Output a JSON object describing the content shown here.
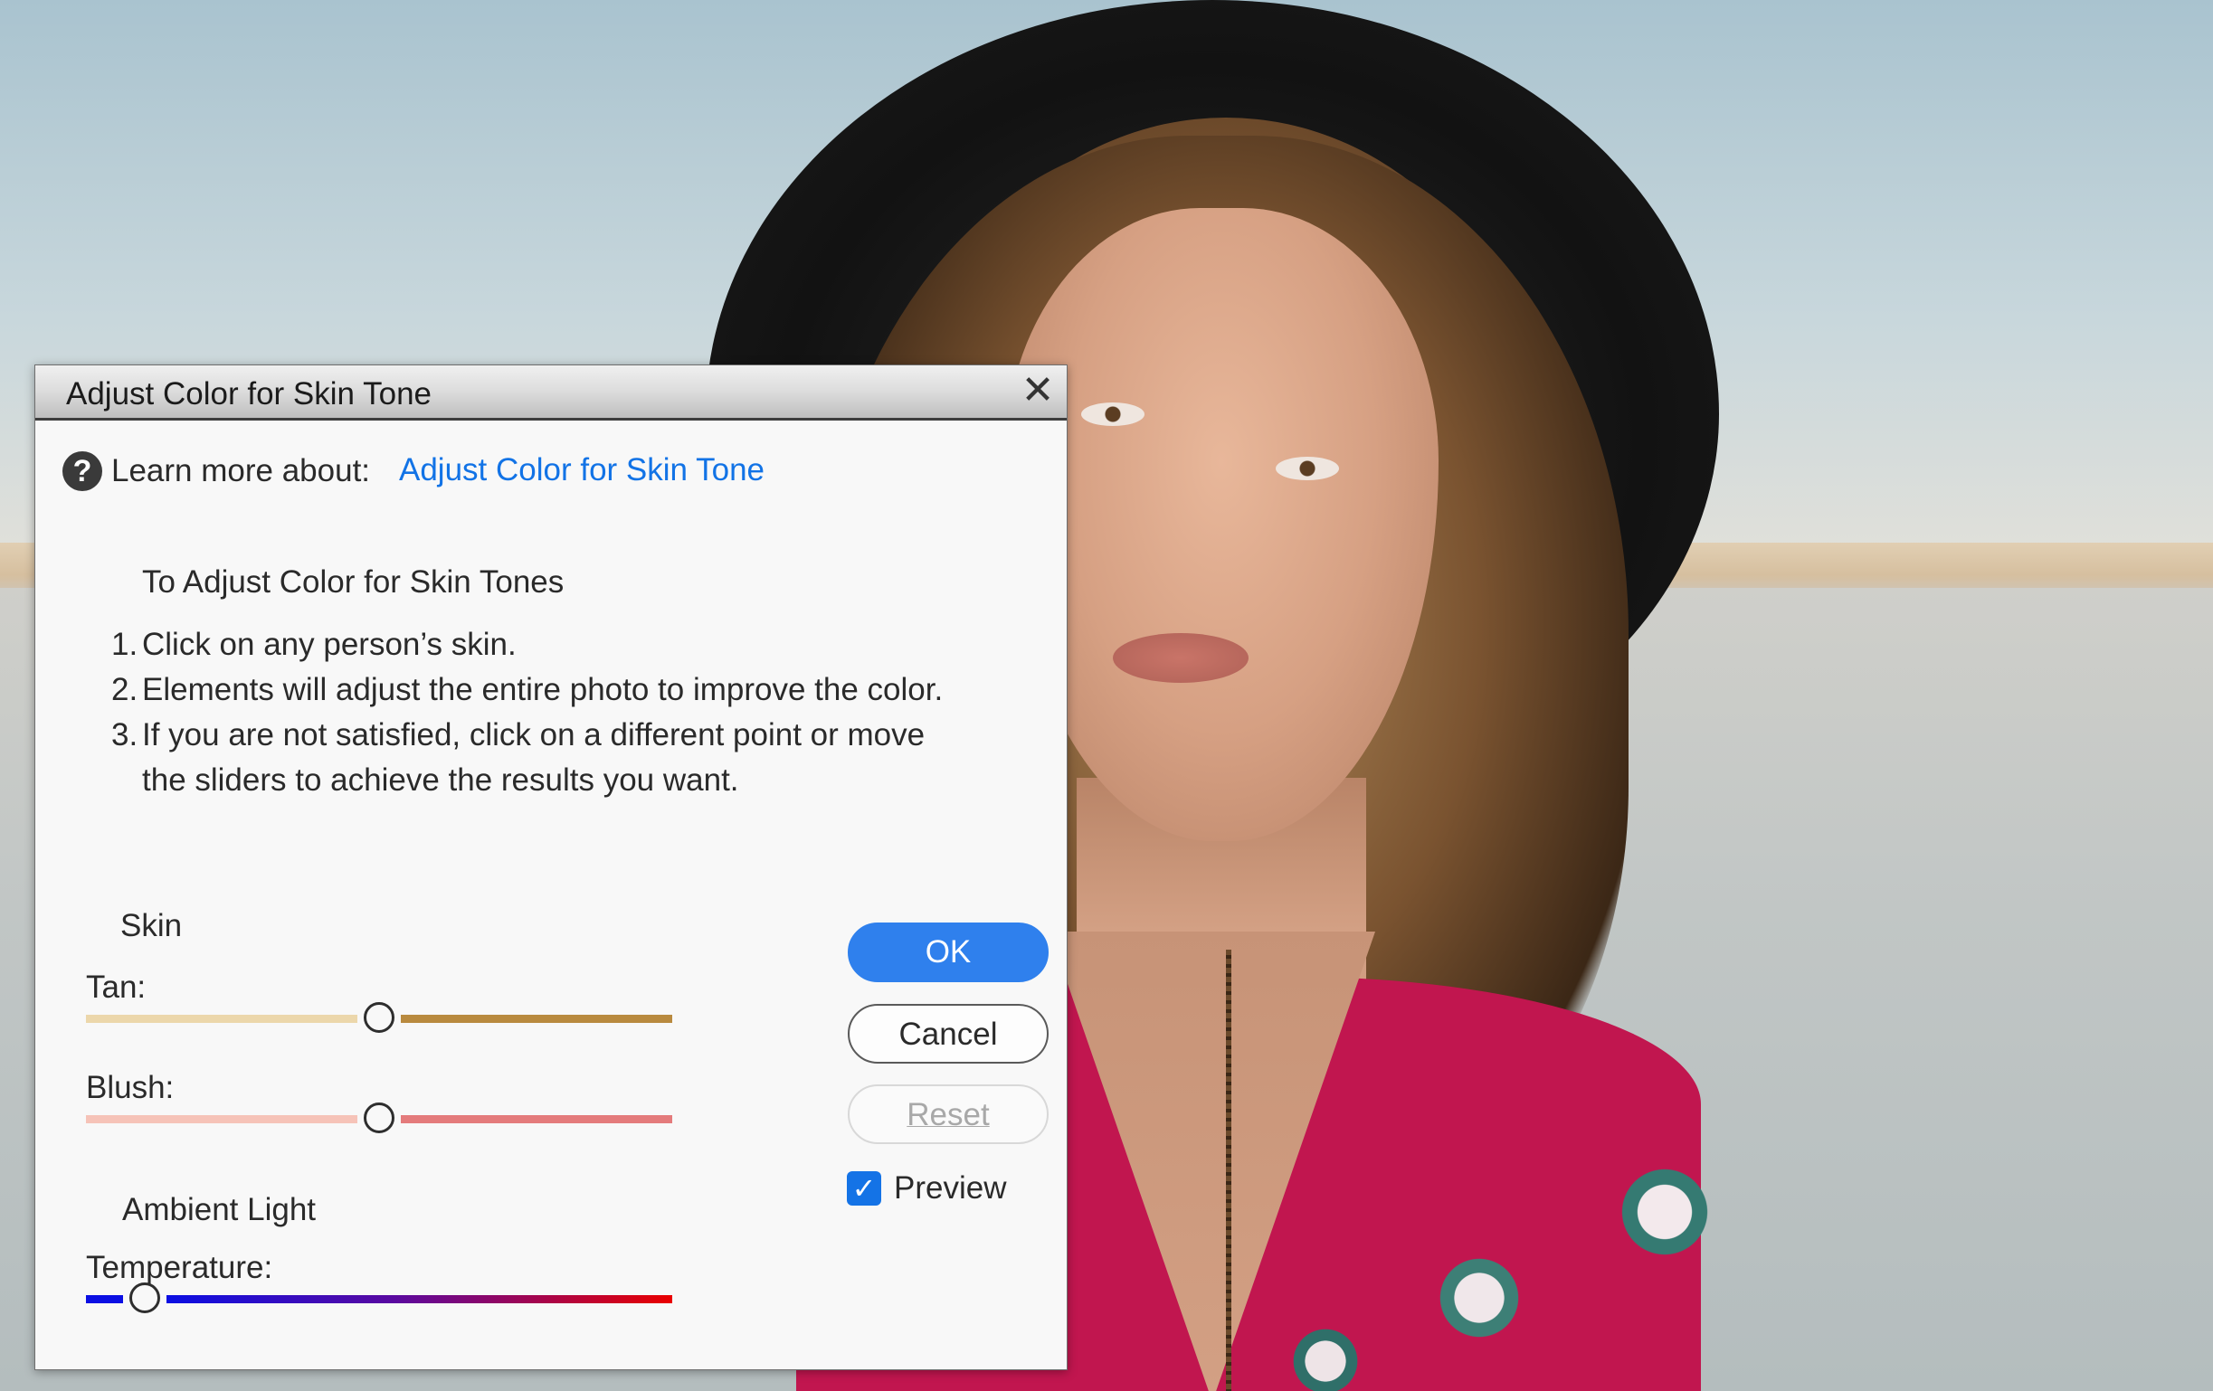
{
  "dialog": {
    "title": "Adjust Color for Skin Tone",
    "close_icon": "close-icon",
    "help": {
      "icon": "help-icon",
      "icon_glyph": "?",
      "label": "Learn more about:",
      "link": "Adjust Color for Skin Tone"
    },
    "instructions": {
      "title": "To Adjust Color for Skin Tones",
      "steps": [
        {
          "num": "1.",
          "text": "Click on any person’s skin."
        },
        {
          "num": "2.",
          "text": "Elements will adjust the entire photo to improve the color."
        },
        {
          "num": "3.",
          "text": "If you are not satisfied, click on a different point or move"
        }
      ],
      "step3_cont": "the sliders to achieve the results you want."
    },
    "skin": {
      "section": "Skin",
      "tan_label": "Tan:",
      "tan_value": 0.5,
      "blush_label": "Blush:",
      "blush_value": 0.5
    },
    "ambient": {
      "section": "Ambient Light",
      "temperature_label": "Temperature:",
      "temperature_value": 0.1
    },
    "buttons": {
      "ok": "OK",
      "cancel": "Cancel",
      "reset": "Reset"
    },
    "preview": {
      "label": "Preview",
      "checked": true,
      "check_glyph": "✓"
    },
    "colors": {
      "link": "#1273e6",
      "ok_button": "#2f80ed",
      "checkbox": "#1473e6",
      "tan_left": "#ecd7ab",
      "tan_right": "#b98a3f",
      "blush_left": "#f6c3b8",
      "blush_right": "#e47b7c",
      "temp_left": "#0b0fe3",
      "temp_right": "#ea0000"
    }
  }
}
